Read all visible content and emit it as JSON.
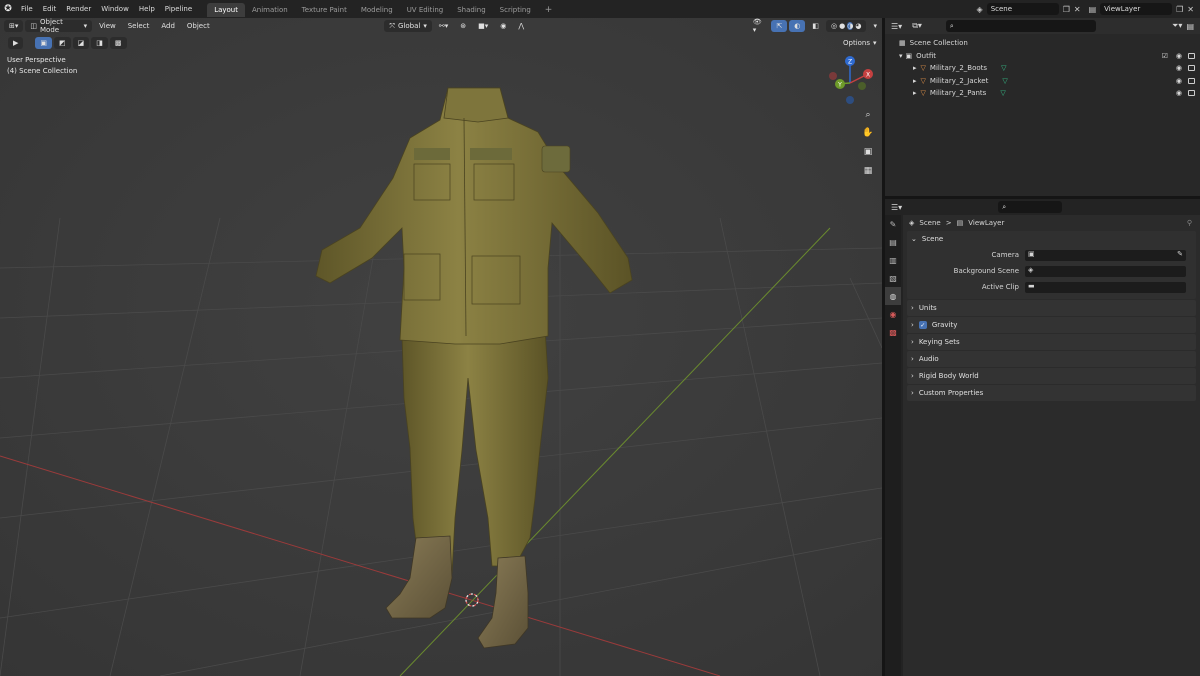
{
  "topbar": {
    "menus": [
      "File",
      "Edit",
      "Render",
      "Window",
      "Help",
      "Pipeline"
    ],
    "workspaces": [
      "Layout",
      "Animation",
      "Texture Paint",
      "Modeling",
      "UV Editing",
      "Shading",
      "Scripting"
    ],
    "active_workspace": "Layout",
    "add_workspace": "+",
    "scene_name": "Scene",
    "view_layer": "ViewLayer"
  },
  "viewport_header": {
    "mode": "Object Mode",
    "menus": [
      "View",
      "Select",
      "Add",
      "Object"
    ],
    "transform_orientation": "Global",
    "options": "Options"
  },
  "viewport": {
    "perspective": "User Perspective",
    "collection": "(4) Scene Collection",
    "gizmo": {
      "x": "X",
      "y": "Y",
      "z": "Z"
    }
  },
  "outliner": {
    "root": "Scene Collection",
    "collection": "Outfit",
    "objects": [
      "Military_2_Boots",
      "Military_2_Jacket",
      "Military_2_Pants"
    ]
  },
  "properties": {
    "breadcrumb_scene": "Scene",
    "breadcrumb_sep": ">",
    "breadcrumb_layer": "ViewLayer",
    "scene_panel": "Scene",
    "camera_label": "Camera",
    "background_label": "Background Scene",
    "clip_label": "Active Clip",
    "panels": [
      "Units",
      "Gravity",
      "Keying Sets",
      "Audio",
      "Rigid Body World",
      "Custom Properties"
    ],
    "gravity_checked": true
  },
  "colors": {
    "accent": "#4772b3",
    "viewport_bg": "#3c3c3c",
    "grid_x_axis": "#9b3b3b",
    "grid_y_axis": "#6a8b2e",
    "outfit": "#7a703c"
  }
}
